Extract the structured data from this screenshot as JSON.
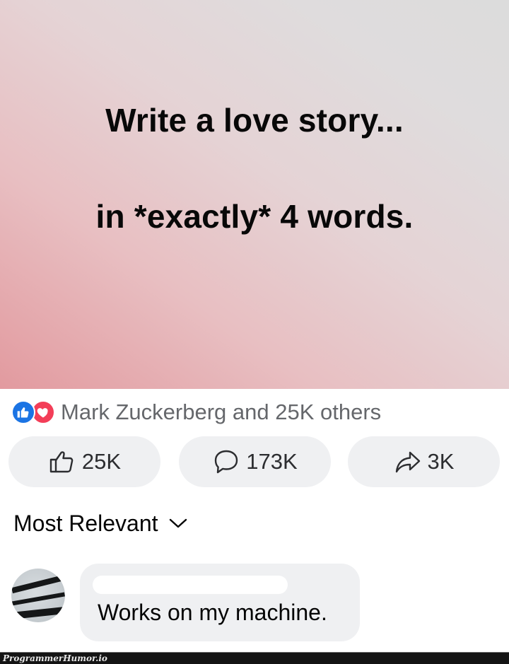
{
  "post": {
    "line1": "Write a love story...",
    "line2": "in *exactly* 4 words."
  },
  "reactions": {
    "icons": [
      "like-icon",
      "love-icon"
    ],
    "summary": "Mark Zuckerberg and 25K others"
  },
  "actions": {
    "like": {
      "icon": "thumbs-up-icon",
      "count": "25K"
    },
    "comment": {
      "icon": "comment-bubble-icon",
      "count": "173K"
    },
    "share": {
      "icon": "share-arrow-icon",
      "count": "3K"
    }
  },
  "comments_sort": {
    "label": "Most Relevant",
    "icon": "chevron-down-icon"
  },
  "comment": {
    "text": "Works on my machine."
  },
  "footer": {
    "watermark": "ProgrammerHumor.io"
  },
  "colors": {
    "like_blue": "#1b74e4",
    "love_red": "#f33e58",
    "pill_bg": "#eff0f2",
    "secondary_text": "#65676b"
  }
}
